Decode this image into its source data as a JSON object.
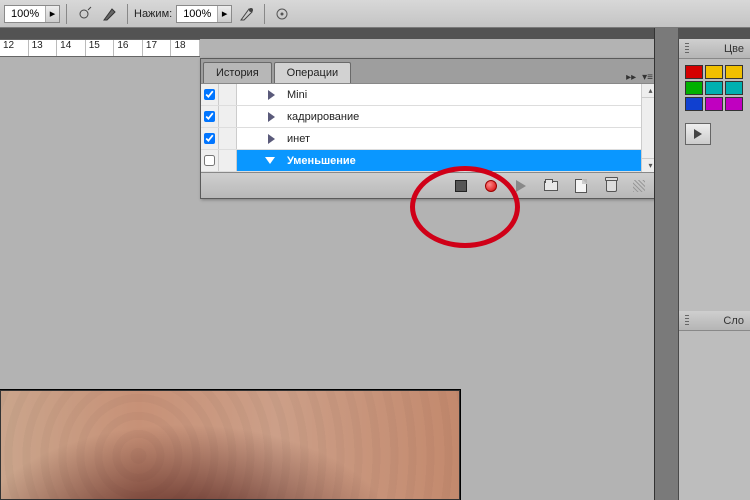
{
  "toolbar": {
    "zoom_value": "100%",
    "pressure_label": "Нажим:",
    "pressure_value": "100%"
  },
  "ruler": [
    "12",
    "13",
    "14",
    "15",
    "16",
    "17",
    "18"
  ],
  "panel": {
    "tabs": {
      "history": "История",
      "actions": "Операции"
    },
    "rows": [
      {
        "label": "Mini",
        "checked": true,
        "expanded": false
      },
      {
        "label": "кадрирование",
        "checked": true,
        "expanded": false
      },
      {
        "label": "инет",
        "checked": true,
        "expanded": false
      },
      {
        "label": "Уменьшение",
        "checked": false,
        "expanded": true,
        "selected": true
      }
    ]
  },
  "right": {
    "tab1": "Цве",
    "tab2": "Сло"
  }
}
